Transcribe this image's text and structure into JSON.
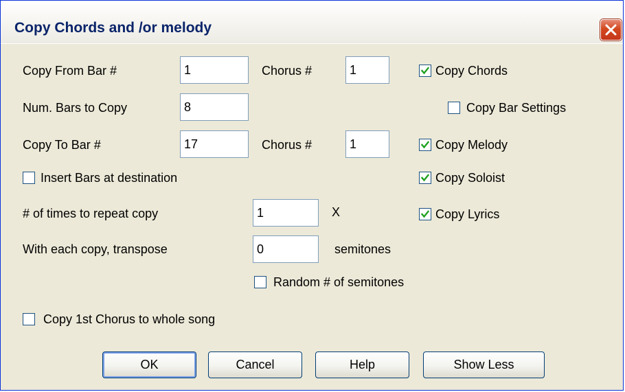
{
  "window": {
    "title": "Copy Chords and /or melody"
  },
  "fields": {
    "copy_from_bar": {
      "label": "Copy From Bar #",
      "value": "1"
    },
    "copy_from_chorus": {
      "label": "Chorus #",
      "value": "1"
    },
    "num_bars": {
      "label": "Num. Bars to Copy",
      "value": "8"
    },
    "copy_to_bar": {
      "label": "Copy To Bar #",
      "value": "17"
    },
    "copy_to_chorus": {
      "label": "Chorus #",
      "value": "1"
    },
    "repeat_times": {
      "label": "# of times to repeat copy",
      "value": "1",
      "suffix": "X"
    },
    "transpose": {
      "label": "With each copy, transpose",
      "value": "0",
      "suffix": "semitones"
    }
  },
  "checkboxes": {
    "copy_chords": {
      "label": "Copy Chords",
      "checked": true
    },
    "copy_bar_settings": {
      "label": "Copy Bar Settings",
      "checked": false
    },
    "copy_melody": {
      "label": "Copy Melody",
      "checked": true
    },
    "copy_soloist": {
      "label": "Copy Soloist",
      "checked": true
    },
    "copy_lyrics": {
      "label": "Copy Lyrics",
      "checked": true
    },
    "insert_bars": {
      "label": "Insert Bars at destination",
      "checked": false
    },
    "random_semitones": {
      "label": "Random # of semitones",
      "checked": false
    },
    "copy_first_chorus": {
      "label": "Copy 1st Chorus to whole song",
      "checked": false
    }
  },
  "buttons": {
    "ok": "OK",
    "cancel": "Cancel",
    "help": "Help",
    "show_less": "Show Less"
  },
  "icons": {
    "close": "close-icon",
    "check": "checkmark-icon"
  },
  "colors": {
    "title_text": "#0a246a",
    "dialog_bg": "#ece9d8",
    "close_button": "#d3481f",
    "check_green": "#21a121"
  }
}
